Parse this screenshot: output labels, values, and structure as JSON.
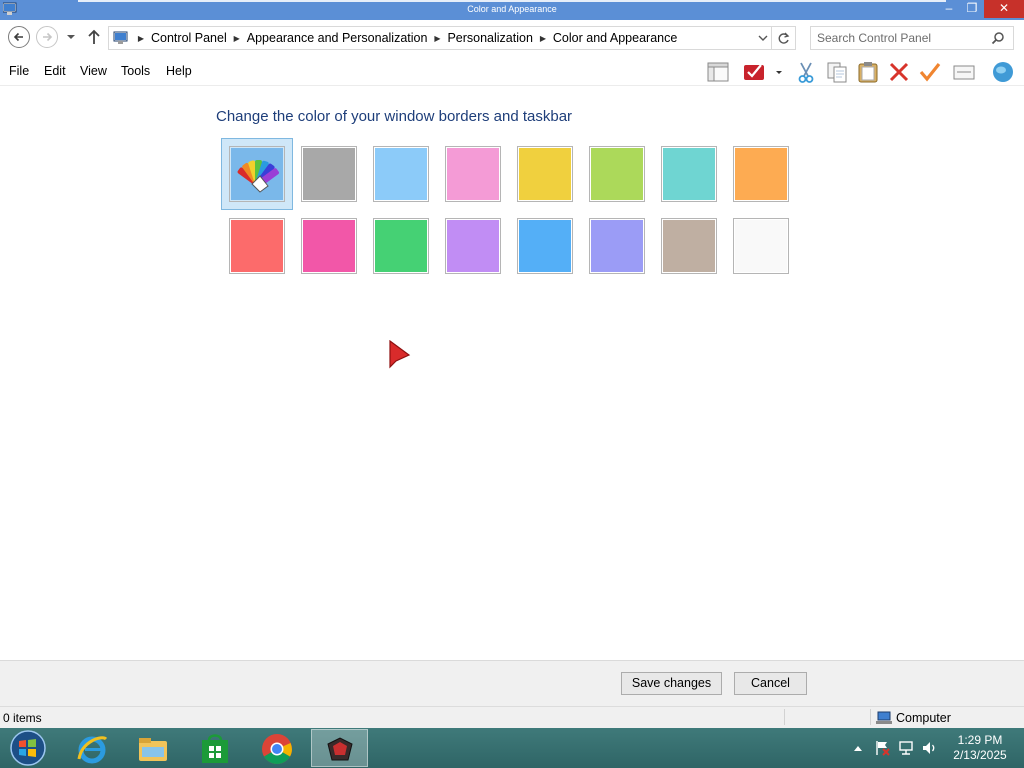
{
  "window": {
    "title": "Color and Appearance",
    "minimize_glyph": "–",
    "maximize_glyph": "❐",
    "close_glyph": "✕"
  },
  "address_bar": {
    "breadcrumbs": [
      "Control Panel",
      "Appearance and Personalization",
      "Personalization",
      "Color and Appearance"
    ],
    "search_placeholder": "Search Control Panel"
  },
  "menu": {
    "items": [
      "File",
      "Edit",
      "View",
      "Tools",
      "Help"
    ]
  },
  "toolbar_icons": [
    "layout-panel-icon",
    "red-checkmark-dropdown-icon",
    "cut-icon",
    "copy-icon",
    "paste-icon",
    "delete-icon",
    "checkmark-icon",
    "properties-icon",
    "globe-icon"
  ],
  "content": {
    "heading": "Change the color of your window borders and taskbar",
    "selected_swatch": "automatic-color-wheel",
    "swatch_rows": [
      [
        "automatic",
        "#a8a8a8",
        "#8ccbf9",
        "#f49bd6",
        "#f0d03e",
        "#acd95a",
        "#6fd5d2",
        "#fdab52"
      ],
      [
        "#fc6b6b",
        "#f257a8",
        "#45d174",
        "#c18df4",
        "#54aff7",
        "#9b9cf6",
        "#bfafa2",
        "#f9f9f9"
      ]
    ]
  },
  "footer": {
    "save_label": "Save changes",
    "cancel_label": "Cancel"
  },
  "status_bar": {
    "items_text": "0 items",
    "zone_text": "Computer"
  },
  "taskbar": {
    "pinned": [
      "start-orb",
      "internet-explorer",
      "file-explorer",
      "windows-store",
      "chrome",
      "control-panel-color-active"
    ],
    "clock_time": "1:29 PM",
    "clock_date": "2/13/2025"
  },
  "colors": {
    "titlebar": "#5b8fd6",
    "close_button": "#c7312a",
    "heading_text": "#1e3e7a",
    "taskbar": "#3a7474",
    "selected_swatch_bg": "#cfe7f8"
  }
}
